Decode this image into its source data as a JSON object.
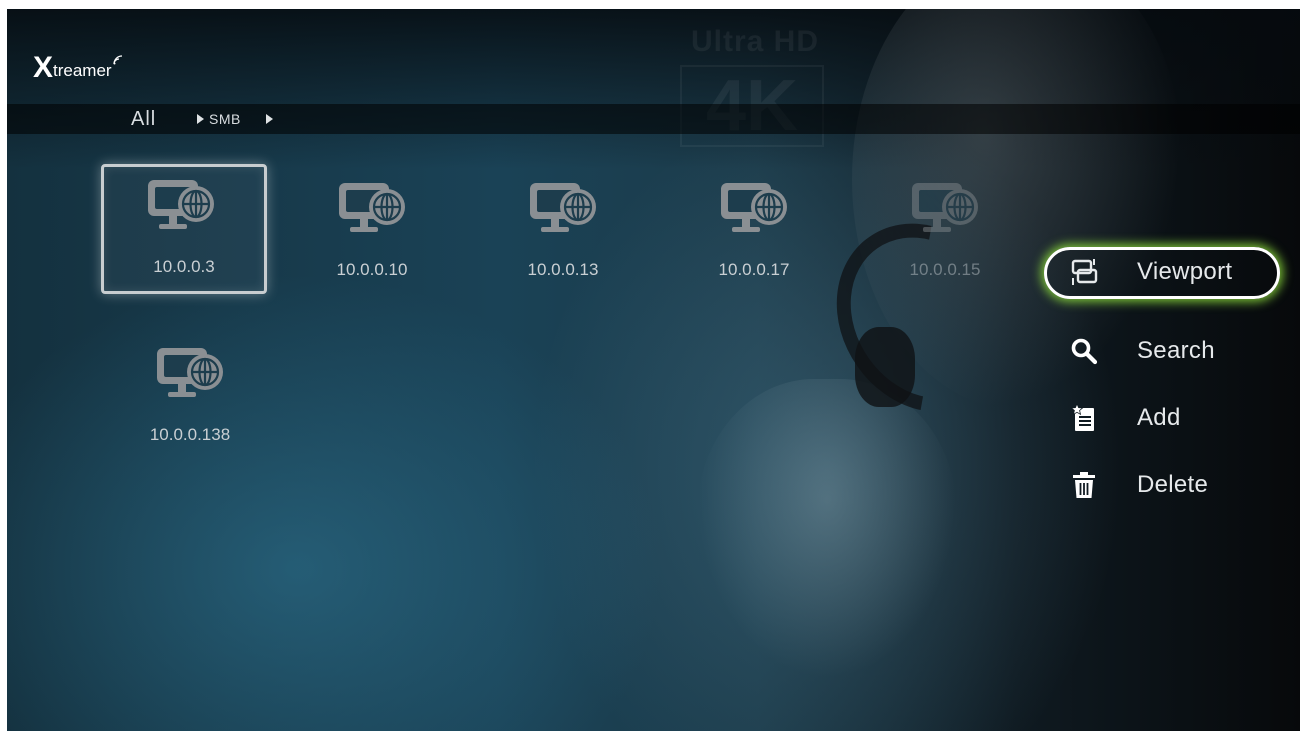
{
  "app": {
    "logo_x": "X",
    "logo_rest": "treamer"
  },
  "background": {
    "watermark_line1": "Ultra HD",
    "watermark_line2": "4K"
  },
  "breadcrumb": {
    "root": "All",
    "path": "SMB"
  },
  "devices": [
    {
      "label": "10.0.0.3",
      "selected": true,
      "icon": "network-computer-icon"
    },
    {
      "label": "10.0.0.10",
      "selected": false,
      "icon": "network-computer-icon"
    },
    {
      "label": "10.0.0.13",
      "selected": false,
      "icon": "network-computer-icon"
    },
    {
      "label": "10.0.0.17",
      "selected": false,
      "icon": "network-computer-icon"
    },
    {
      "label": "10.0.0.15",
      "selected": false,
      "icon": "network-computer-icon"
    },
    {
      "label": "10.0.0.138",
      "selected": false,
      "icon": "network-computer-icon"
    }
  ],
  "menu": [
    {
      "label": "Viewport",
      "icon": "viewport-icon",
      "active": true
    },
    {
      "label": "Search",
      "icon": "search-icon",
      "active": false
    },
    {
      "label": "Add",
      "icon": "add-icon",
      "active": false
    },
    {
      "label": "Delete",
      "icon": "trash-icon",
      "active": false
    }
  ],
  "colors": {
    "focus_glow": "#8cdc3c",
    "text": "#e6e9eb",
    "icon_gray": "#8a8f93"
  }
}
